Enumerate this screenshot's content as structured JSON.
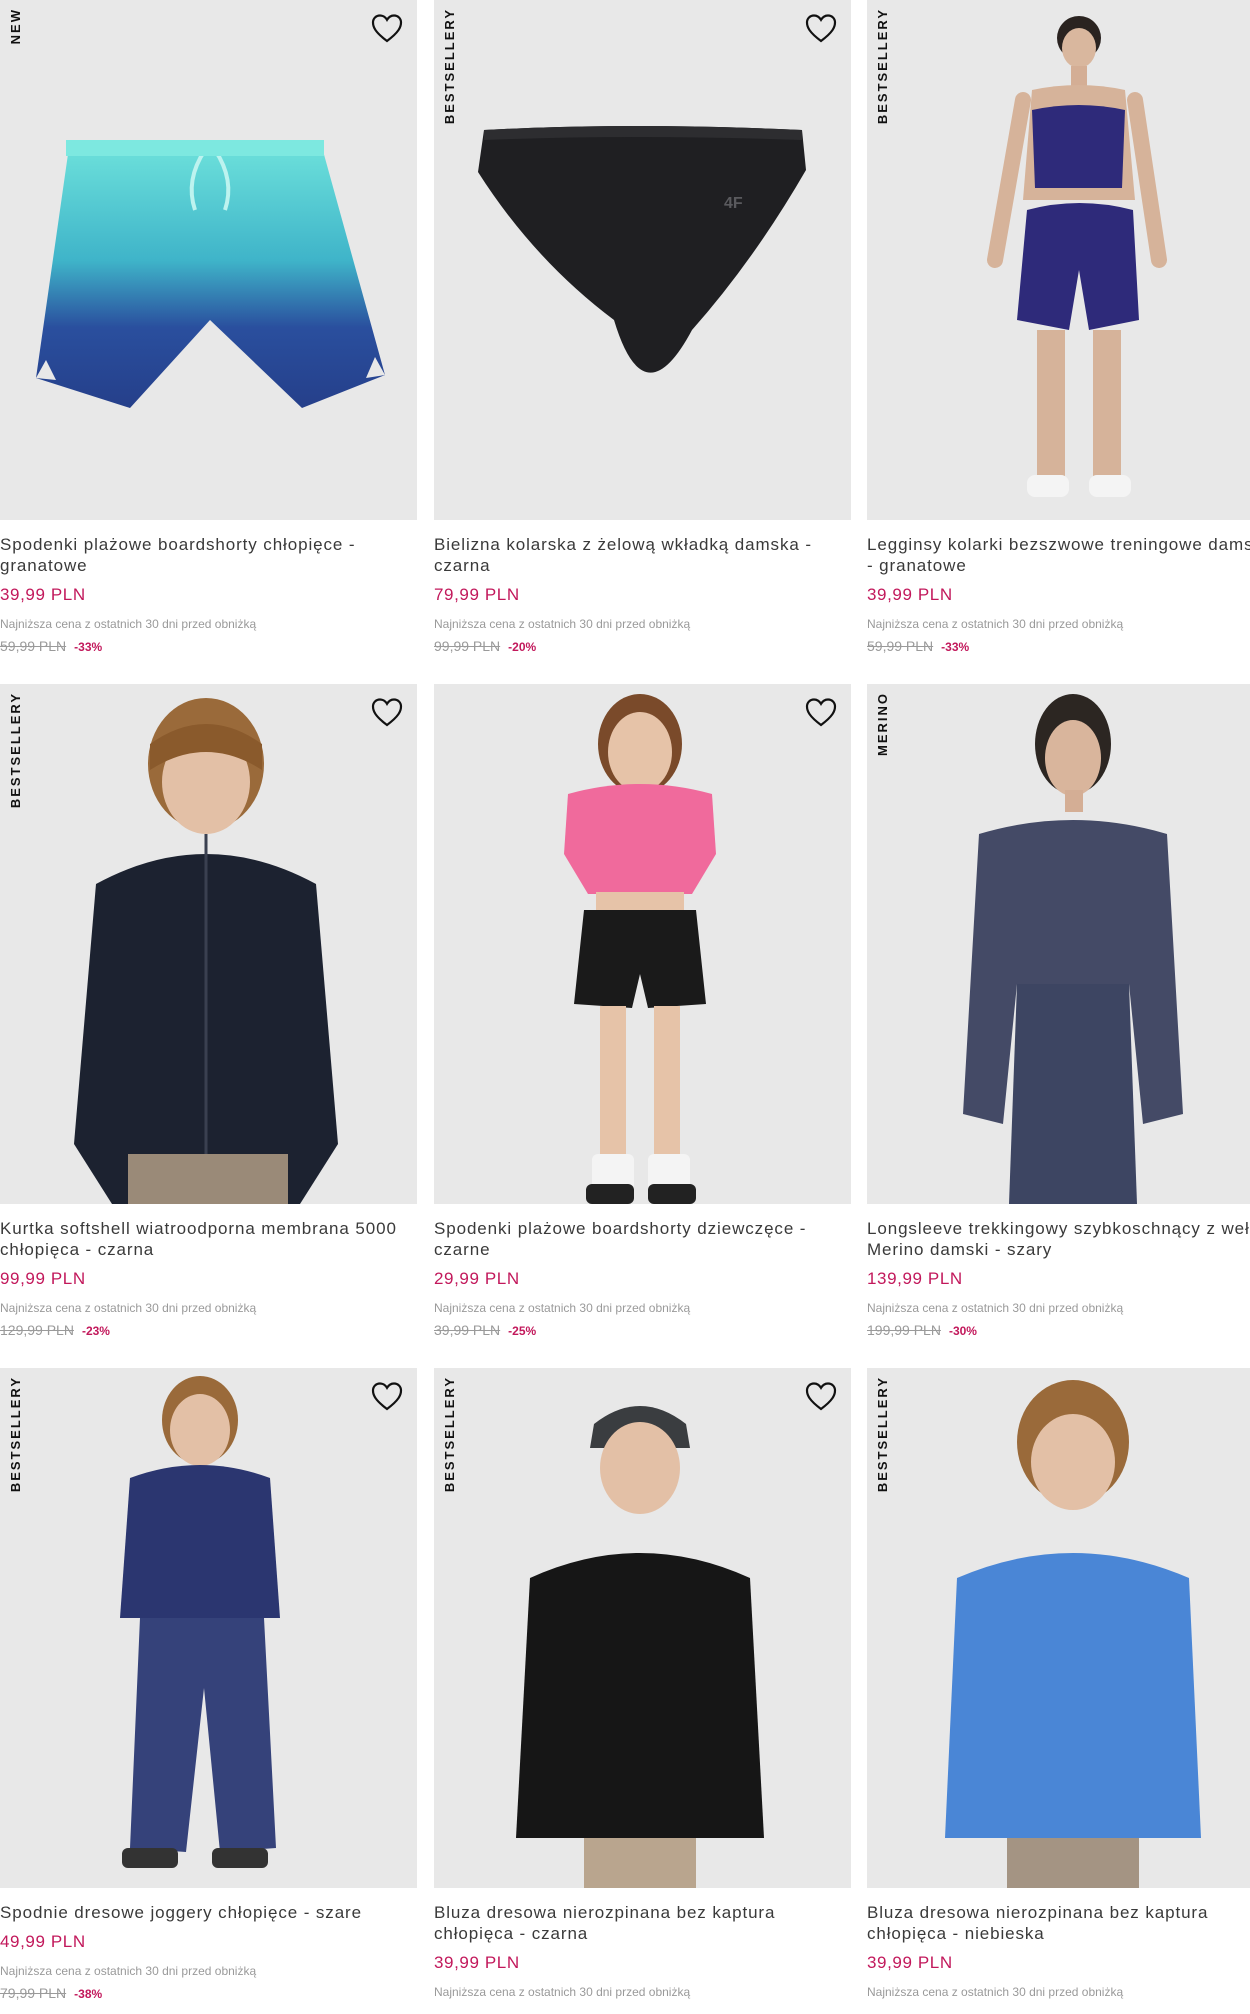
{
  "accent_color": "#c2185b",
  "products": [
    {
      "badge": "NEW",
      "title": "Spodenki plażowe boardshorty chłopięce - granatowe",
      "price": "39,99 PLN",
      "lowest_label": "Najniższa cena z ostatnich 30 dni przed obniżką",
      "old_price": "59,99 PLN",
      "discount": "-33%",
      "image": "boardshorts-ombre",
      "favorite_icon": "heart-outline-icon"
    },
    {
      "badge": "BESTSELLERY",
      "title": "Bielizna kolarska z żelową wkładką damska - czarna",
      "price": "79,99 PLN",
      "lowest_label": "Najniższa cena z ostatnich 30 dni przed obniżką",
      "old_price": "99,99 PLN",
      "discount": "-20%",
      "image": "cycling-briefs-black",
      "favorite_icon": "heart-outline-icon"
    },
    {
      "badge": "BESTSELLERY",
      "title": "Legginsy kolarki bezszwowe treningowe damskie - granatowe",
      "price": "39,99 PLN",
      "lowest_label": "Najniższa cena z ostatnich 30 dni przed obniżką",
      "old_price": "59,99 PLN",
      "discount": "-33%",
      "image": "woman-navy-bike-shorts",
      "favorite_icon": "heart-outline-icon"
    },
    {
      "badge": "BESTSELLERY",
      "title": "Kurtka softshell wiatroodporna membrana 5000 chłopięca - czarna",
      "price": "99,99 PLN",
      "lowest_label": "Najniższa cena z ostatnich 30 dni przed obniżką",
      "old_price": "129,99 PLN",
      "discount": "-23%",
      "image": "boy-black-softshell",
      "favorite_icon": "heart-outline-icon"
    },
    {
      "badge": "",
      "title": "Spodenki plażowe boardshorty dziewczęce - czarne",
      "price": "29,99 PLN",
      "lowest_label": "Najniższa cena z ostatnich 30 dni przed obniżką",
      "old_price": "39,99 PLN",
      "discount": "-25%",
      "image": "girl-pink-top-black-shorts",
      "favorite_icon": "heart-outline-icon"
    },
    {
      "badge": "MERINO",
      "title": "Longsleeve trekkingowy szybkoschnący z wełną Merino damski - szary",
      "price": "139,99 PLN",
      "lowest_label": "Najniższa cena z ostatnich 30 dni przed obniżką",
      "old_price": "199,99 PLN",
      "discount": "-30%",
      "image": "woman-grey-longsleeve",
      "favorite_icon": "heart-outline-icon"
    },
    {
      "badge": "BESTSELLERY",
      "title": "Spodnie dresowe joggery chłopięce - szare",
      "price": "49,99 PLN",
      "lowest_label": "Najniższa cena z ostatnich 30 dni przed obniżką",
      "old_price": "79,99 PLN",
      "discount": "-38%",
      "image": "boy-navy-tracksuit",
      "favorite_icon": "heart-outline-icon"
    },
    {
      "badge": "BESTSELLERY",
      "title": "Bluza dresowa nierozpinana bez kaptura chłopięca - czarna",
      "price": "39,99 PLN",
      "lowest_label": "Najniższa cena z ostatnich 30 dni przed obniżką",
      "old_price": "",
      "discount": "",
      "image": "boy-black-sweatshirt-cap",
      "favorite_icon": "heart-outline-icon"
    },
    {
      "badge": "BESTSELLERY",
      "title": "Bluza dresowa nierozpinana bez kaptura chłopięca - niebieska",
      "price": "39,99 PLN",
      "lowest_label": "Najniższa cena z ostatnich 30 dni przed obniżką",
      "old_price": "",
      "discount": "",
      "image": "boy-blue-sweatshirt",
      "favorite_icon": "heart-outline-icon"
    }
  ]
}
